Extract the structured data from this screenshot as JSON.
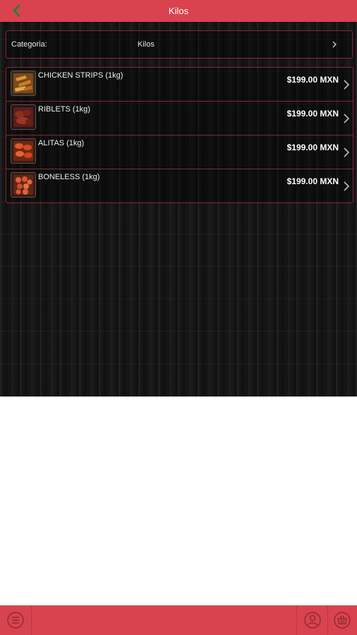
{
  "header": {
    "title": "Kilos",
    "back_icon": "chevron-left-icon",
    "back_icon_color": "#2e7d32"
  },
  "category": {
    "label": "Categoria:",
    "value": "Kilos"
  },
  "products": [
    {
      "name": "CHICKEN STRIPS (1kg)",
      "price": "$199.00 MXN",
      "thumb": "chicken-strips-icon"
    },
    {
      "name": "RIBLETS (1kg)",
      "price": "$199.00 MXN",
      "thumb": "riblets-icon"
    },
    {
      "name": "ALITAS (1kg)",
      "price": "$199.00 MXN",
      "thumb": "alitas-icon"
    },
    {
      "name": "BONELESS (1kg)",
      "price": "$199.00 MXN",
      "thumb": "boneless-icon"
    }
  ],
  "bottom_bar": {
    "menu_icon": "menu-list-icon",
    "user_icon": "user-icon",
    "cart_icon": "basket-icon"
  },
  "colors": {
    "brand_red": "#d9434f",
    "border_red": "#8a2730",
    "wall_dark": "#141414"
  }
}
